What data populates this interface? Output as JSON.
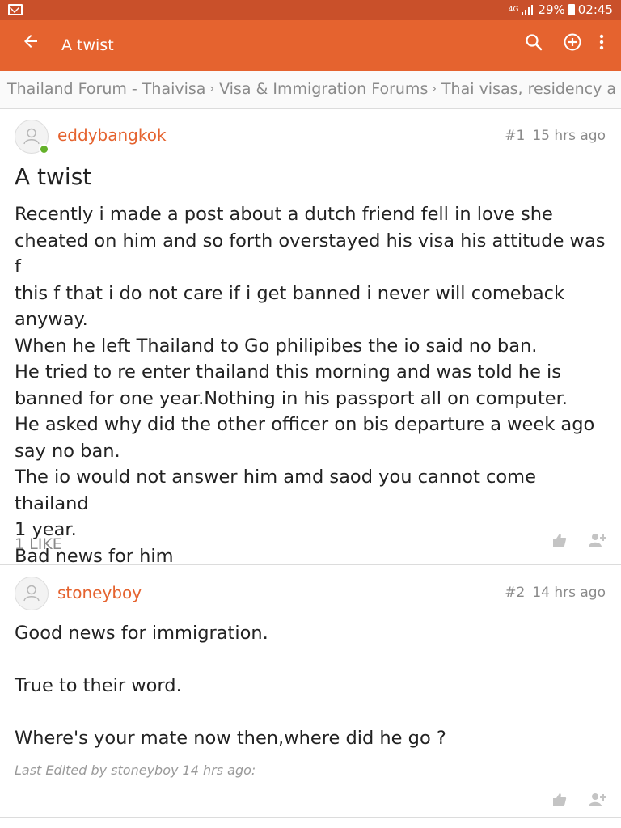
{
  "status": {
    "network": "4G",
    "battery": "29%",
    "time": "02:45"
  },
  "appbar": {
    "title": "A twist",
    "icons": [
      "back-arrow-icon",
      "search-icon",
      "add-circle-icon",
      "more-vert-icon"
    ]
  },
  "breadcrumb": {
    "items": [
      "Thailand Forum - Thaivisa",
      "Visa & Immigration Forums",
      "Thai visas, residency a"
    ]
  },
  "posts": [
    {
      "author": "eddybangkok",
      "number": "#1",
      "time": "15 hrs ago",
      "title": "A twist",
      "lines": [
        "Recently i made a post about a dutch friend fell in love she",
        "cheated on him and so forth overstayed his visa his attitude was f",
        "this f that i do not care if i get banned i never will comeback",
        "anyway.",
        "When he left Thailand to Go philipibes the io said no ban.",
        "He tried to re enter thailand this morning and was told he is",
        "banned for one year.Nothing in his passport all on computer.",
        "He asked why did the other officer on bis departure a week ago",
        "say no ban.",
        "The io would not answer him amd saod you cannot come thailand",
        "1 year.",
        "Bad news for him"
      ],
      "likes": "1 LIKE"
    },
    {
      "author": "stoneyboy",
      "number": "#2",
      "time": "14 hrs ago",
      "lines": [
        "Good news for immigration.",
        "",
        "True to their word.",
        "",
        "Where's your mate now then,where did he go ?"
      ],
      "edited": "Last Edited by stoneyboy 14 hrs ago:"
    }
  ],
  "colors": {
    "statusbar": "#c9502a",
    "appbar": "#e5632f",
    "accent": "#e5632f",
    "online": "#64b12a"
  }
}
